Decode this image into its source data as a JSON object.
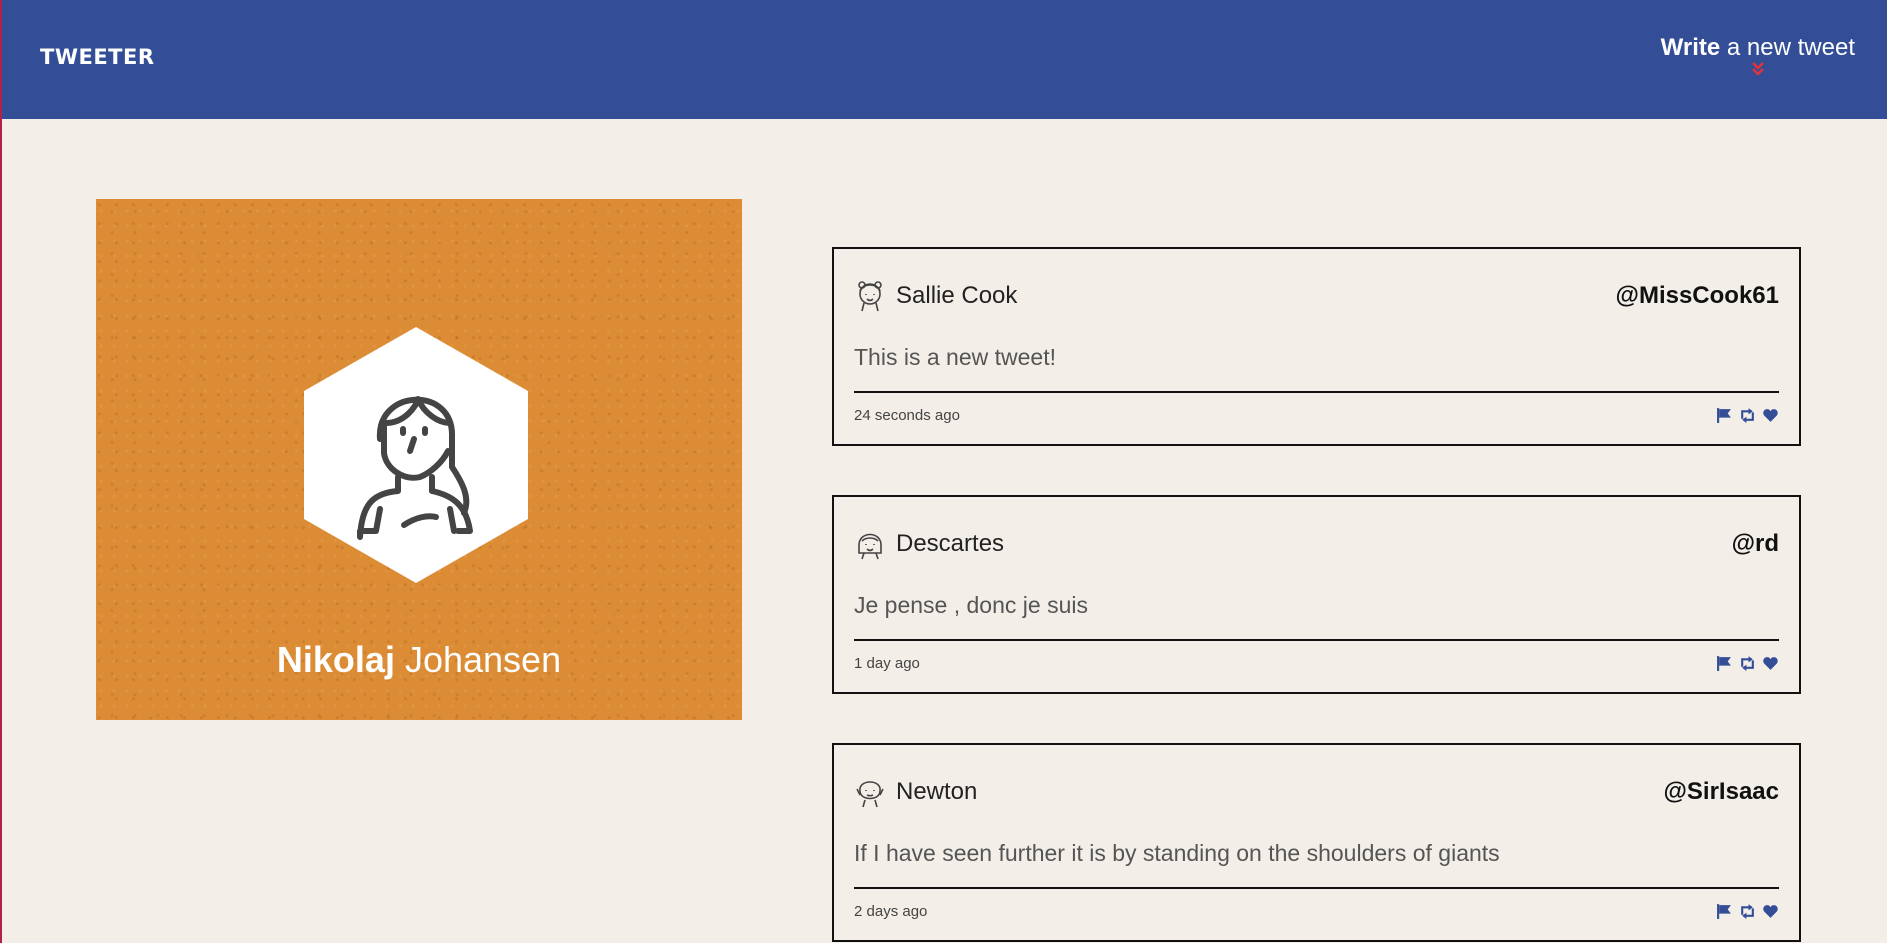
{
  "nav": {
    "logo": "TWEETER",
    "compose_bold": "Write",
    "compose_rest": " a new tweet"
  },
  "profile": {
    "first_name": "Nikolaj",
    "last_name": " Johansen"
  },
  "colors": {
    "nav_bg": "#334e97",
    "accent_red": "#e0333c",
    "profile_bg": "#dc8c34",
    "action_blue": "#334e97"
  },
  "tweets": [
    {
      "name": "Sallie Cook",
      "handle": "@MissCook61",
      "text": "This is a new tweet!",
      "time": "24 seconds ago"
    },
    {
      "name": "Descartes",
      "handle": "@rd",
      "text": "Je pense , donc je suis",
      "time": "1 day ago"
    },
    {
      "name": "Newton",
      "handle": "@SirIsaac",
      "text": "If I have seen further it is by standing on the shoulders of giants",
      "time": "2 days ago"
    }
  ],
  "icons": [
    "chevron-double-down-icon",
    "flag-icon",
    "retweet-icon",
    "heart-icon",
    "user-avatar-icon"
  ]
}
